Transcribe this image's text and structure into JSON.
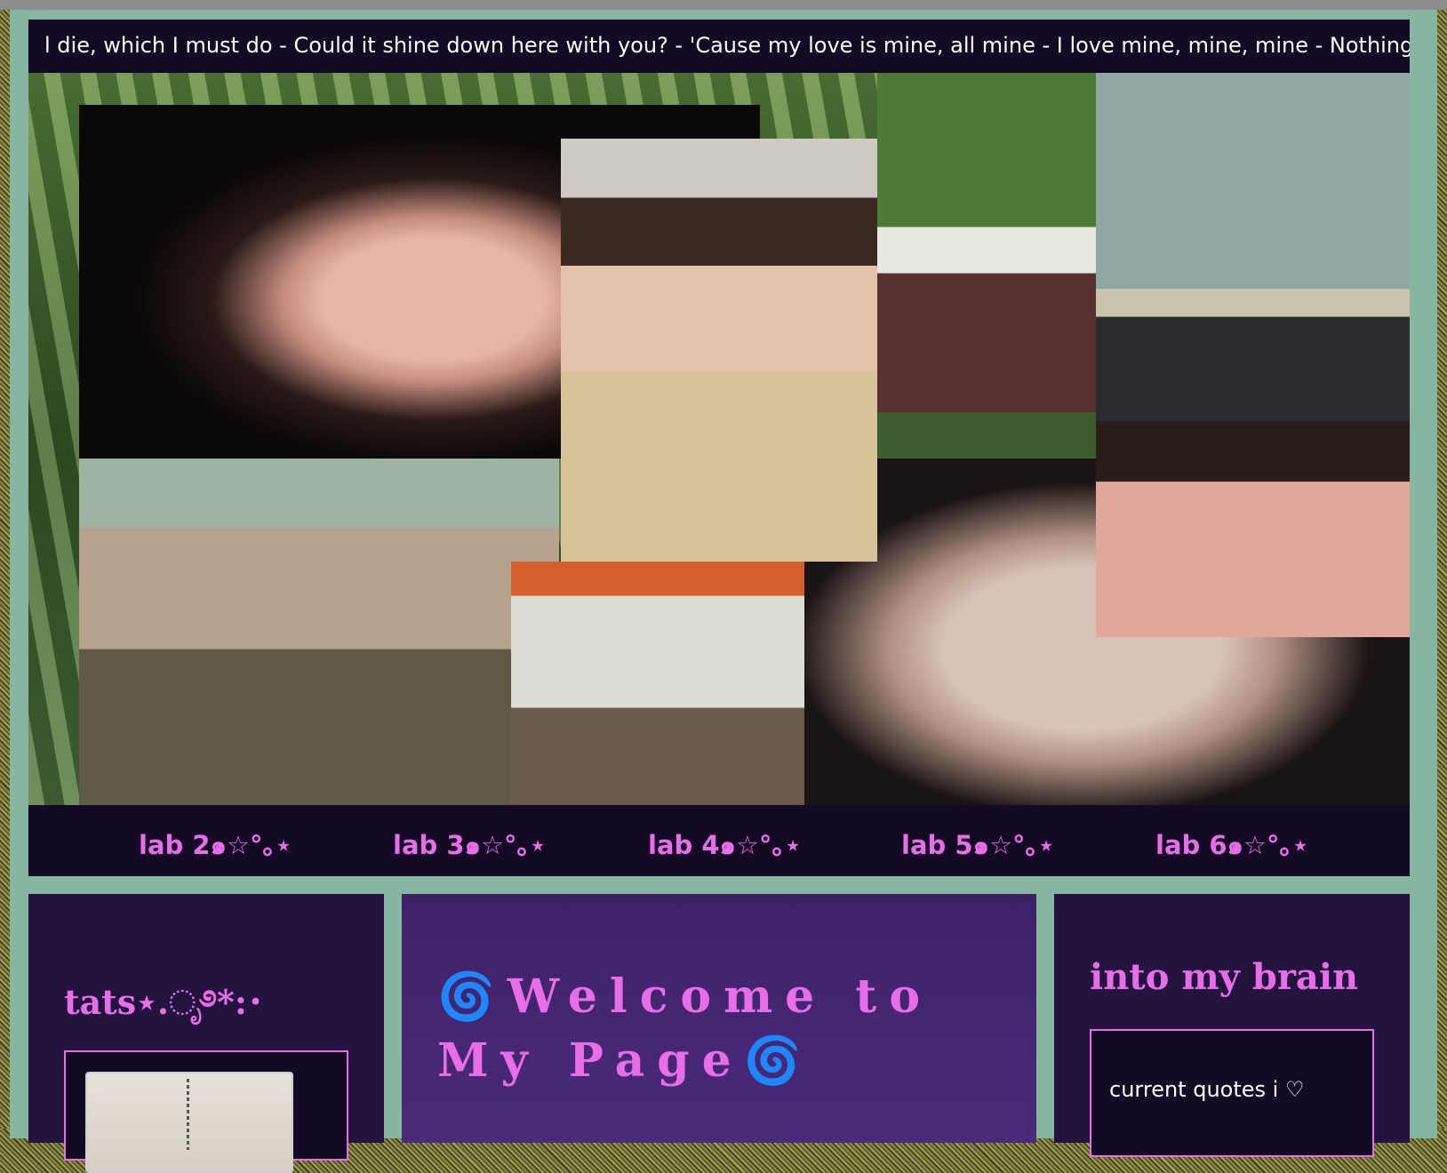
{
  "marquee": {
    "text": "l die, which I must do - Could it shine down here with you? - 'Cause my love is mine, all mine - I love mine, mine, mine - Nothing"
  },
  "lab_nav": {
    "items": [
      {
        "label": "lab 2๑☆°｡⋆"
      },
      {
        "label": "lab 3๑☆°｡⋆"
      },
      {
        "label": "lab 4๑☆°｡⋆"
      },
      {
        "label": "lab 5๑☆°｡⋆"
      },
      {
        "label": "lab 6๑☆°｡⋆"
      }
    ]
  },
  "left_panel": {
    "title": "tats⋆.ೃ࿔*:･"
  },
  "main_panel": {
    "title": "🌀Welcome to My Page🌀"
  },
  "right_panel": {
    "title": "into my brain",
    "quotes_label": "current quotes i ♡"
  },
  "colors": {
    "accent": "#e86ee8",
    "dark_panel": "#140a26",
    "frame": "#86b69f",
    "mid_panel": "#4a2a7a"
  }
}
